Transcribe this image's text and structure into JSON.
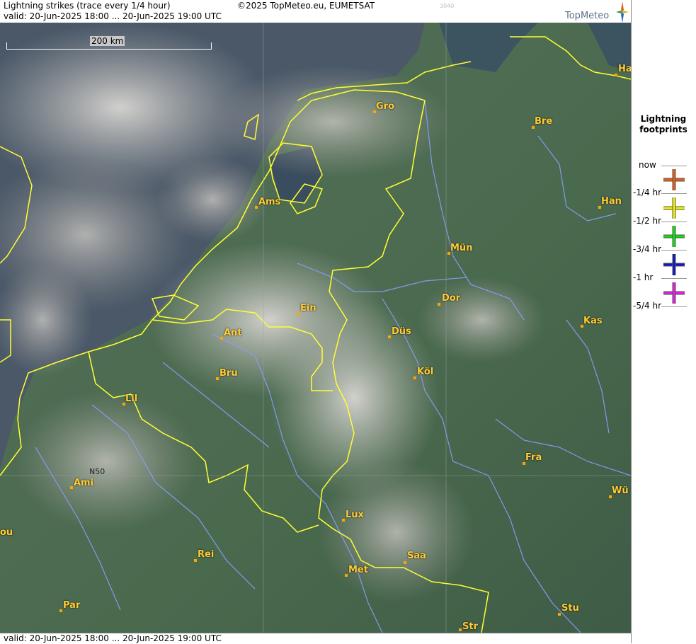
{
  "header": {
    "title": "Lightning strikes (trace every 1/4 hour)",
    "valid": "valid:  20-Jun-2025 18:00 ... 20-Jun-2025 19:00 UTC",
    "copyright": "©2025 TopMeteo.eu, EUMETSAT",
    "code": "3040",
    "logo_text": "TopMeteo"
  },
  "footer": {
    "valid": "valid:  20-Jun-2025 18:00 ... 20-Jun-2025 19:00 UTC"
  },
  "map": {
    "scale_label": "200 km",
    "grid_label": "N50",
    "border_color": "#ffff33",
    "river_color": "#8c9cff",
    "city_color": "#ffcc33",
    "cities": {
      "gro": "Gro",
      "ham": "Ha",
      "bre": "Bre",
      "ams": "Ams",
      "han": "Han",
      "mun": "Mün",
      "ein": "Ein",
      "dor": "Dor",
      "ant": "Ant",
      "dus": "Düs",
      "kas": "Kas",
      "bru": "Bru",
      "kol": "Köl",
      "lil": "Lil",
      "fra": "Fra",
      "ami": "Ami",
      "wur": "Wü",
      "lux": "Lux",
      "rou": "ou",
      "saa": "Saa",
      "rei": "Rei",
      "met": "Met",
      "stu": "Stu",
      "par": "Par",
      "str": "Str"
    }
  },
  "legend": {
    "title_line1": "Lightning",
    "title_line2": "footprints",
    "labels": [
      "now",
      "-1/4 hr",
      "-1/2 hr",
      "-3/4 hr",
      "-1 hr",
      "-5/4 hr"
    ],
    "colors": [
      "#e0601a",
      "#f0f000",
      "#10e010",
      "#1018c0",
      "#e020e0"
    ]
  }
}
